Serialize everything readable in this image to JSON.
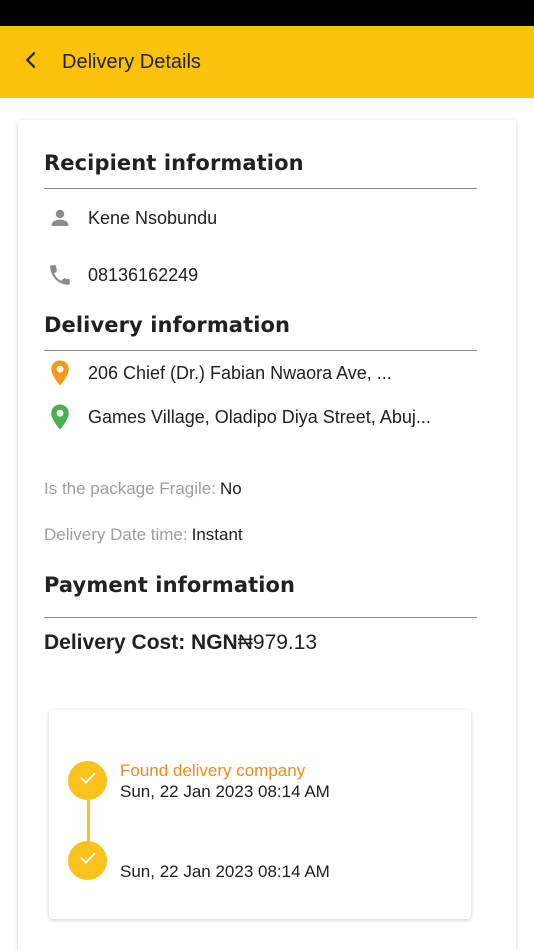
{
  "app_bar": {
    "title": "Delivery Details"
  },
  "recipient": {
    "heading": "Recipient information",
    "name": "Kene Nsobundu",
    "phone": "08136162249"
  },
  "delivery": {
    "heading": "Delivery information",
    "pickup_address": "206 Chief (Dr.) Fabian Nwaora Ave, ...",
    "dropoff_address": "Games Village, Oladipo Diya Street, Abuj...",
    "fragile_label": "Is the package Fragile:",
    "fragile_value": "No",
    "datetime_label": "Delivery Date time:",
    "datetime_value": "Instant"
  },
  "payment": {
    "heading": "Payment information",
    "cost_label": "Delivery Cost: NGN",
    "cost_value": "₦979.13"
  },
  "timeline": [
    {
      "status": "Found delivery company",
      "time": "Sun, 22 Jan 2023 08:14 AM"
    },
    {
      "status": "",
      "time": "Sun, 22 Jan 2023 08:14 AM"
    }
  ],
  "colors": {
    "app_bar": "#fbc20b",
    "pickup_pin": "#f39a1e",
    "dropoff_pin": "#4caf50",
    "timeline_accent": "#f9c21c",
    "status_text": "#ef8a1f"
  },
  "icons": {
    "back": "arrow-back-icon",
    "person": "person-icon",
    "phone": "phone-icon",
    "pickup": "location-pin-icon",
    "dropoff": "location-pin-icon",
    "check": "check-icon"
  }
}
